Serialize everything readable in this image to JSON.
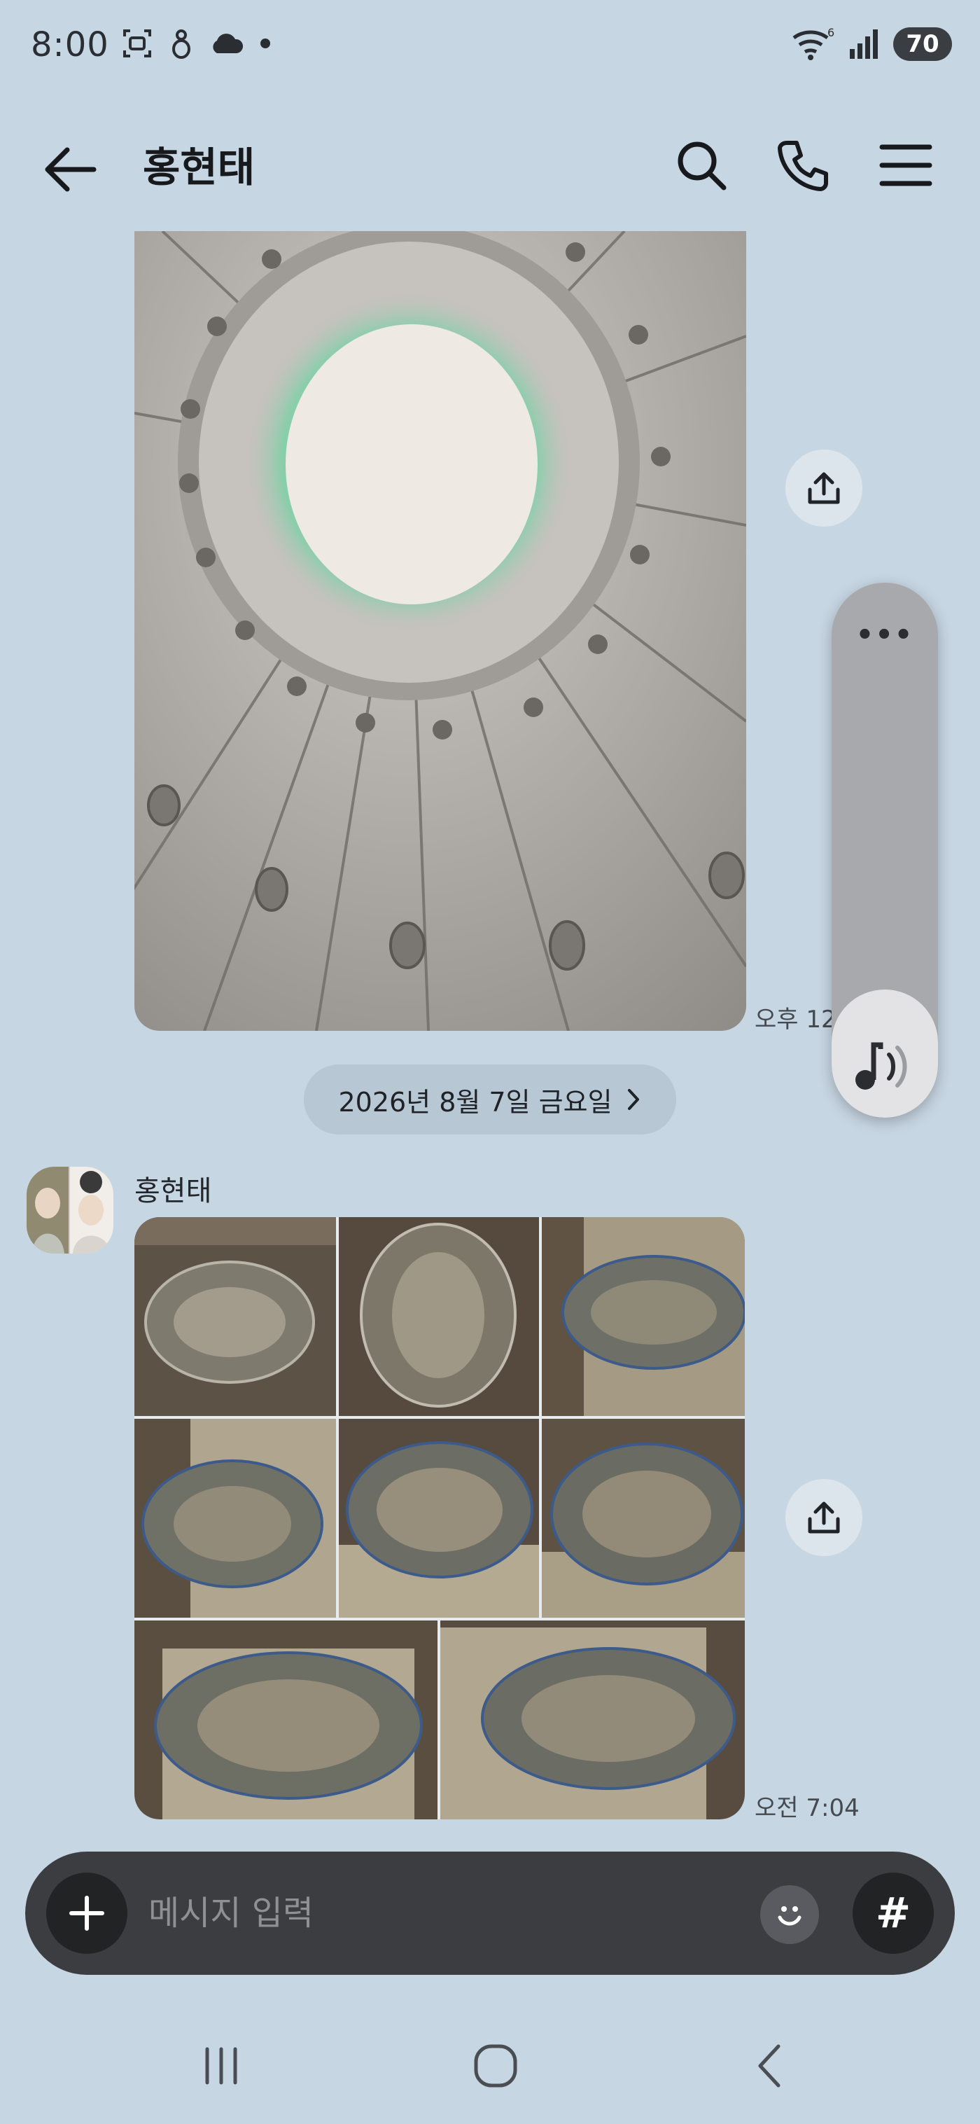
{
  "status_bar": {
    "time": "8:00",
    "battery": "70",
    "wifi_badge": "6"
  },
  "header": {
    "title": "홍현태"
  },
  "messages": {
    "photo_1_time": "오후 12",
    "date_divider": "2026년 8월 7일 금요일",
    "sender": "홍현태",
    "photo_group_time": "오전 7:04"
  },
  "input": {
    "placeholder": "메시지 입력",
    "hash_label": "#"
  },
  "colors": {
    "background": "#c7d6e3",
    "input_bar": "#3c3d41",
    "glow": "#2ee08a"
  },
  "volume": {
    "level": 0.24
  }
}
